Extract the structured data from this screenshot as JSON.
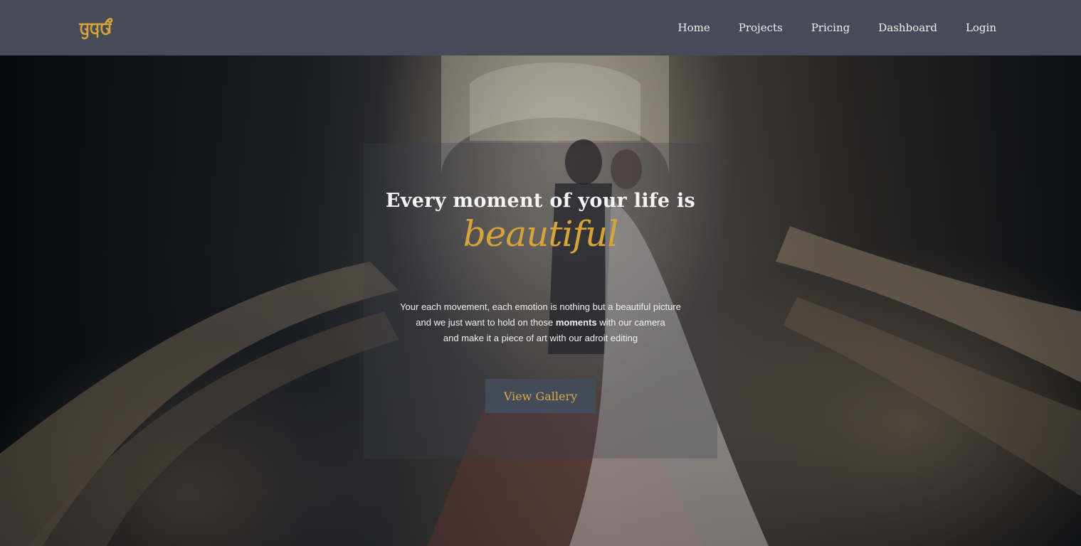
{
  "brand": {
    "logo_icon": "brand-logo-glyph",
    "accent_color": "#d6a539"
  },
  "nav": {
    "items": [
      {
        "label": "Home"
      },
      {
        "label": "Projects"
      },
      {
        "label": "Pricing"
      },
      {
        "label": "Dashboard"
      },
      {
        "label": "Login"
      }
    ],
    "background": "#454c57"
  },
  "hero": {
    "headline": "Every moment of your life is",
    "highlight": "beautiful",
    "tagline": {
      "line1": "Your each movement, each emotion is nothing but a beautiful picture",
      "line2_before": "and we just want to hold on those ",
      "line2_bold": "moments",
      "line2_after": " with our camera",
      "line3": "and make it a piece of art with our adroit editing"
    },
    "cta_label": "View Gallery"
  }
}
